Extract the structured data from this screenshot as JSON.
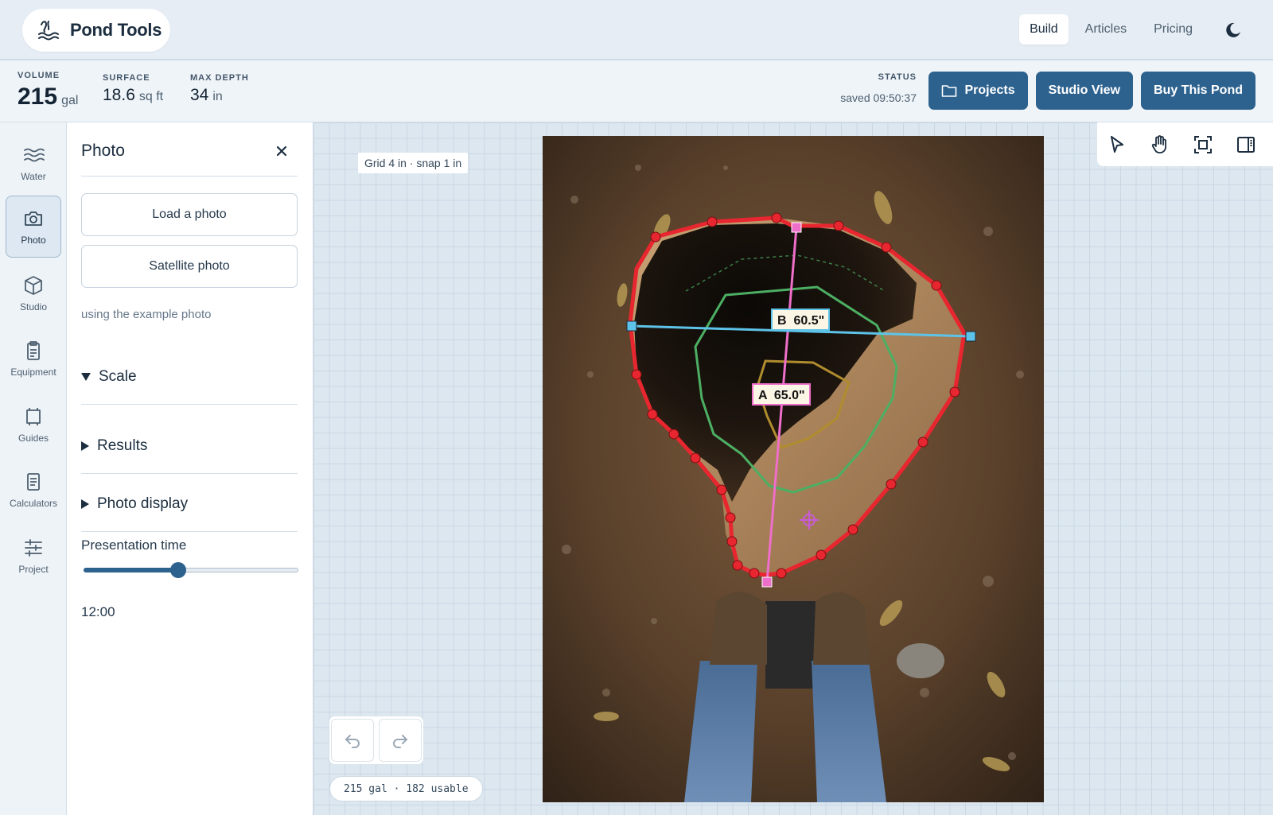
{
  "app": {
    "name": "Pond Tools"
  },
  "nav": {
    "items": [
      "Build",
      "Articles",
      "Pricing"
    ],
    "active": "Build"
  },
  "stats": {
    "volume": {
      "label": "VOLUME",
      "value": "215",
      "unit": "gal"
    },
    "surface": {
      "label": "SURFACE",
      "value": "18.6",
      "unit": "sq ft"
    },
    "max_depth": {
      "label": "MAX DEPTH",
      "value": "34",
      "unit": "in"
    },
    "status": {
      "label": "STATUS",
      "value": "saved 09:50:37"
    }
  },
  "header_buttons": {
    "projects": "Projects",
    "studio_view": "Studio View",
    "buy": "Buy This Pond"
  },
  "rail": [
    {
      "label": "Water",
      "icon": "waves-icon"
    },
    {
      "label": "Photo",
      "icon": "camera-icon",
      "active": true
    },
    {
      "label": "Studio",
      "icon": "cube-icon"
    },
    {
      "label": "Equipment",
      "icon": "clipboard-icon"
    },
    {
      "label": "Guides",
      "icon": "crop-icon"
    },
    {
      "label": "Calculators",
      "icon": "document-icon"
    },
    {
      "label": "Project",
      "icon": "sliders-icon"
    }
  ],
  "panel": {
    "title": "Photo",
    "load_photo": "Load a photo",
    "satellite_photo": "Satellite photo",
    "hint": "using the example photo",
    "sections": {
      "scale": "Scale",
      "results": "Results",
      "photo_display": "Photo display"
    },
    "presentation": {
      "label": "Presentation time",
      "value": "12:00",
      "fraction": 0.44
    }
  },
  "canvas": {
    "grid_chip": "Grid 4 in · snap 1 in",
    "dim_a": "A  65.0\"",
    "dim_b": "B  60.5\"",
    "volume_chip": "215 gal · 182 usable"
  },
  "tools": [
    "pointer-icon",
    "hand-icon",
    "fit-frame-icon",
    "panel-toggle-icon"
  ],
  "colors": {
    "accent": "#2d628f",
    "outline": "#e8262f",
    "dim_a": "#ee6fc9",
    "dim_b": "#5ec3e8",
    "contour": "#4caf63",
    "contour_inner": "#b08c2e"
  }
}
